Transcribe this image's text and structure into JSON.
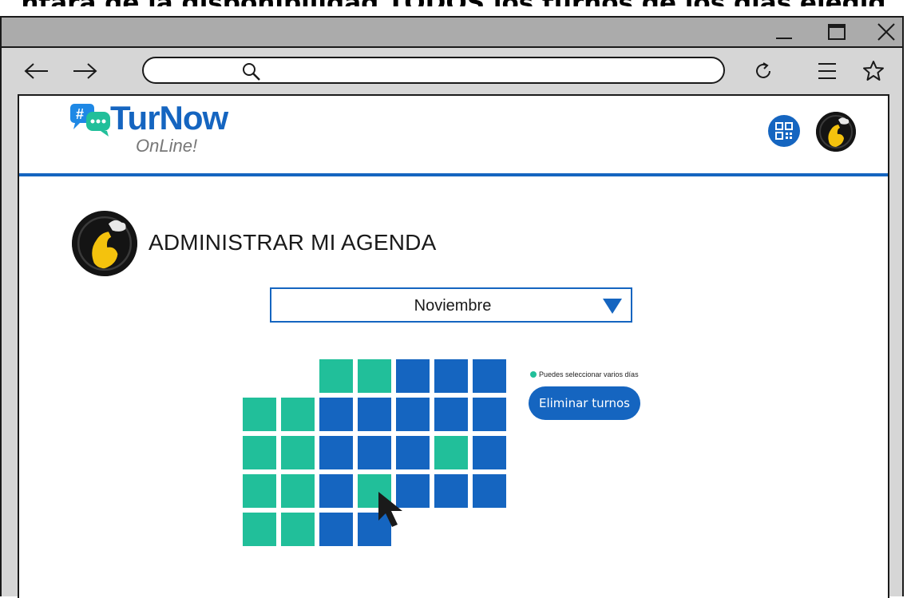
{
  "caption": "ntará de la disponibilidad TODOS los turnos de los días elegid",
  "window": {
    "minimize_icon": "minimize-icon",
    "maximize_icon": "maximize-icon",
    "close_icon": "close-icon"
  },
  "browser": {
    "back_icon": "arrow-left-icon",
    "forward_icon": "arrow-right-icon",
    "search_icon": "search-icon",
    "address_value": "",
    "reload_icon": "reload-icon",
    "menu_icon": "hamburger-menu-icon",
    "bookmark_icon": "star-icon"
  },
  "app": {
    "logo_text": "TurNow",
    "logo_sub": "OnLine!",
    "qr_icon": "qr-code-icon",
    "avatar_icon": "user-avatar"
  },
  "main": {
    "title": "ADMINISTRAR MI AGENDA",
    "month_select": {
      "selected": "Noviembre"
    },
    "hint": "Puedes seleccionar varios días",
    "delete_button": "Eliminar turnos"
  },
  "calendar": {
    "rows": [
      [
        null,
        null,
        "green",
        "green",
        "blue",
        "blue",
        "blue"
      ],
      [
        "green",
        "green",
        "blue",
        "blue",
        "blue",
        "blue",
        "blue"
      ],
      [
        "green",
        "green",
        "blue",
        "blue",
        "blue",
        "green",
        "blue"
      ],
      [
        "green",
        "green",
        "blue",
        "green",
        "blue",
        "blue",
        "blue"
      ],
      [
        "green",
        "green",
        "blue",
        "blue",
        null,
        null,
        null
      ]
    ]
  },
  "colors": {
    "accent_blue": "#1565c0",
    "green": "#21bf9a",
    "window_gray": "#ababab"
  }
}
